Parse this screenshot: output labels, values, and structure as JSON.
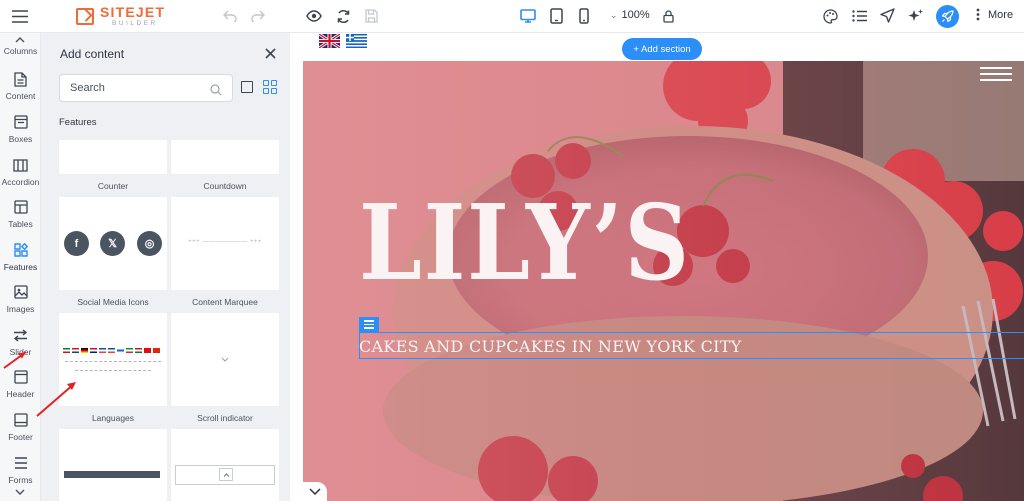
{
  "toolbar": {
    "logo_name": "SITEJET",
    "logo_sub": "BUILDER",
    "zoom": "100%",
    "more_label": "More"
  },
  "rail": {
    "items": [
      {
        "label": "Columns",
        "icon": "columns-icon"
      },
      {
        "label": "Content",
        "icon": "content-icon"
      },
      {
        "label": "Boxes",
        "icon": "boxes-icon"
      },
      {
        "label": "Accordion",
        "icon": "accordion-icon"
      },
      {
        "label": "Tables",
        "icon": "tables-icon"
      },
      {
        "label": "Features",
        "icon": "features-icon",
        "active": true
      },
      {
        "label": "Images",
        "icon": "images-icon"
      },
      {
        "label": "Slider",
        "icon": "slider-icon"
      },
      {
        "label": "Header",
        "icon": "header-icon"
      },
      {
        "label": "Footer",
        "icon": "footer-icon"
      },
      {
        "label": "Forms",
        "icon": "forms-icon"
      }
    ]
  },
  "panel": {
    "title": "Add content",
    "search_placeholder": "Search",
    "section_title": "Features",
    "cards": [
      {
        "label": "Counter"
      },
      {
        "label": "Countdown"
      },
      {
        "label": "Social Media Icons"
      },
      {
        "label": "Content Marquee"
      },
      {
        "label": "Languages"
      },
      {
        "label": "Scroll indicator"
      }
    ],
    "social_icons": [
      "f",
      "𝕏",
      "◎"
    ],
    "marquee_text": "+++ ——————— +++"
  },
  "canvas": {
    "add_section_label": "+ Add section",
    "hero_title": "LILY’S",
    "hero_subtitle": "CAKES AND CUPCAKES IN NEW YORK CITY"
  },
  "colors": {
    "accent": "#2c8ef8",
    "brand": "#f26a36",
    "arrow": "#e02424"
  }
}
